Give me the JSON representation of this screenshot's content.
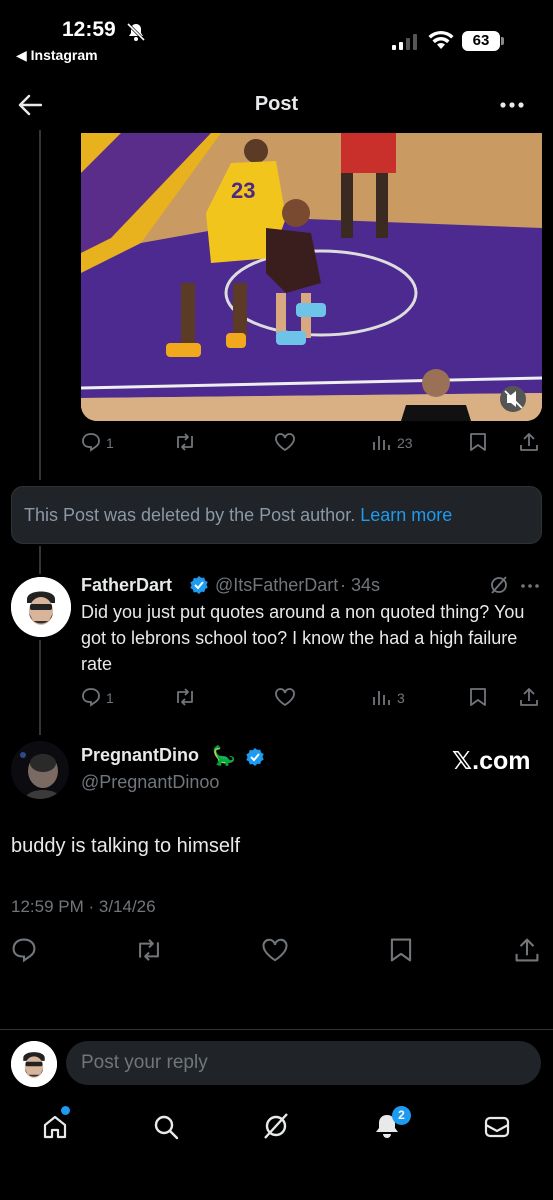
{
  "status_bar": {
    "time": "12:59",
    "back_app": "◀ Instagram",
    "battery": "63"
  },
  "header": {
    "title": "Post"
  },
  "quoted_post": {
    "actions": {
      "replies": "1",
      "views": "23"
    },
    "jersey_number": "23"
  },
  "deleted_notice": {
    "text": "This Post was deleted by the Post author. ",
    "link": "Learn more"
  },
  "reply": {
    "name": "FatherDart",
    "handle": "@ItsFatherDart",
    "time": "· 34s",
    "text": "Did you just put quotes around a non quoted thing? You got to lebrons school too? I know the had a high failure rate",
    "actions": {
      "replies": "1",
      "views": "3"
    }
  },
  "main_post": {
    "name": "PregnantDino",
    "emoji": "🦕",
    "handle": "@PregnantDinoo",
    "watermark": "𝕏.com",
    "text": "buddy is talking to himself",
    "timestamp": "12:59 PM · 3/14/26"
  },
  "reply_bar": {
    "placeholder": "Post your reply"
  },
  "bottom_nav": {
    "notifications_badge": "2"
  },
  "colors": {
    "accent": "#1d9bf0",
    "background": "#000000",
    "muted": "#71767b"
  }
}
